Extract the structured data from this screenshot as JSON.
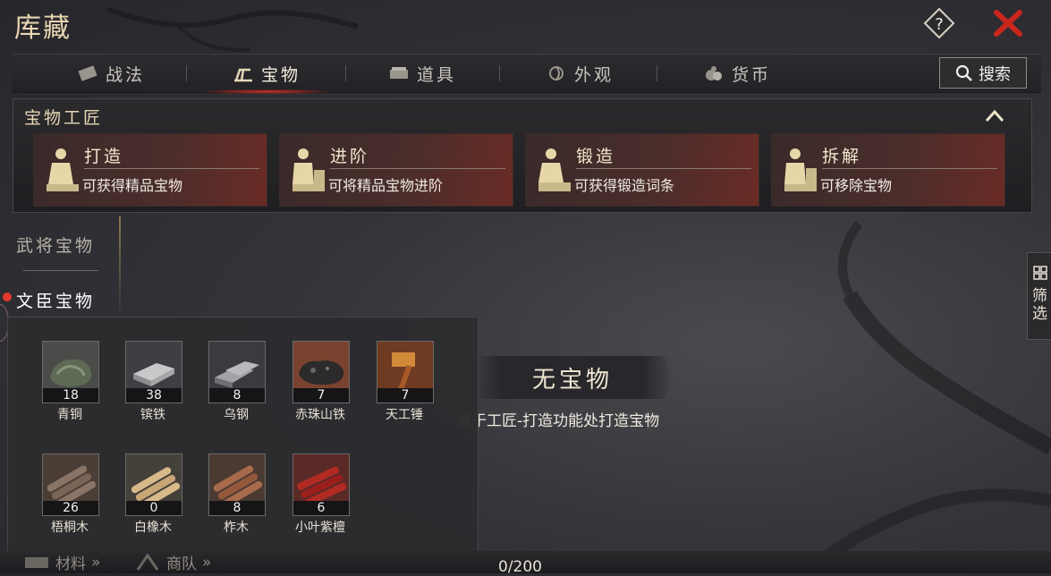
{
  "header": {
    "title": "库藏"
  },
  "tabs": [
    {
      "label": "战法",
      "icon": "scroll-icon",
      "active": false
    },
    {
      "label": "宝物",
      "icon": "treasure-icon",
      "active": true
    },
    {
      "label": "道具",
      "icon": "box-icon",
      "active": false
    },
    {
      "label": "外观",
      "icon": "swirl-icon",
      "active": false
    },
    {
      "label": "货币",
      "icon": "coin-bag-icon",
      "active": false
    }
  ],
  "search_label": "搜索",
  "workshop": {
    "title": "宝物工匠",
    "cards": [
      {
        "name": "打造",
        "desc": "可获得精品宝物"
      },
      {
        "name": "进阶",
        "desc": "可将精品宝物进阶"
      },
      {
        "name": "锻造",
        "desc": "可获得锻造词条"
      },
      {
        "name": "拆解",
        "desc": "可移除宝物"
      }
    ]
  },
  "categories": [
    {
      "label": "武将宝物",
      "active": false
    },
    {
      "label": "文臣宝物",
      "active": true
    }
  ],
  "filter_label": "筛选",
  "empty": {
    "title": "无宝物",
    "hint": "请于工匠-打造功能处打造宝物"
  },
  "materials": [
    {
      "name": "青铜",
      "count": "18",
      "icon": "bronze-ore-icon"
    },
    {
      "name": "镔铁",
      "count": "38",
      "icon": "iron-ingot-icon"
    },
    {
      "name": "乌钢",
      "count": "8",
      "icon": "steel-ingot-icon"
    },
    {
      "name": "赤珠山铁",
      "count": "7",
      "icon": "meteor-iron-icon"
    },
    {
      "name": "天工锤",
      "count": "7",
      "icon": "hammer-icon"
    },
    {
      "name": "梧桐木",
      "count": "26",
      "icon": "wutong-logs-icon"
    },
    {
      "name": "白橡木",
      "count": "0",
      "icon": "oak-logs-icon"
    },
    {
      "name": "柞木",
      "count": "8",
      "icon": "zuo-logs-icon"
    },
    {
      "name": "小叶紫檀",
      "count": "6",
      "icon": "rosewood-logs-icon"
    }
  ],
  "bottom": {
    "materials_label": "材料",
    "team_label": "商队",
    "capacity": "0/200"
  }
}
